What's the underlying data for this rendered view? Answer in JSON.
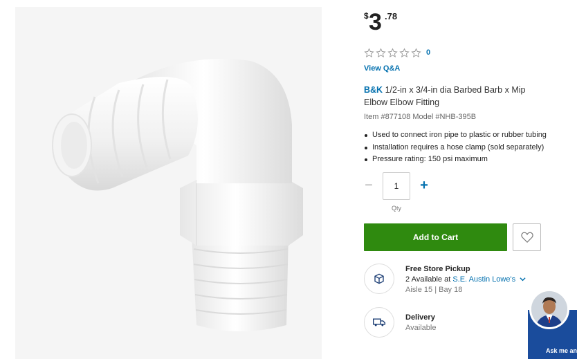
{
  "product": {
    "price": {
      "currency": "$",
      "dollars": "3",
      "cents": ".78"
    },
    "rating": {
      "stars": 0,
      "max_stars": 5,
      "count": "0"
    },
    "view_qa": "View Q&A",
    "title": {
      "brand": "B&K",
      "name": "1/2-in x 3/4-in dia Barbed Barb x Mip Elbow Elbow Fitting"
    },
    "item_model": "Item #877108 Model #NHB-395B",
    "bullets": [
      "Used to connect iron pipe to plastic or rubber tubing",
      "Installation requires a hose clamp (sold separately)",
      "Pressure rating: 150 psi maximum"
    ]
  },
  "quantity": {
    "value": "1",
    "label": "Qty",
    "minus": "−",
    "plus": "+"
  },
  "cart": {
    "add_label": "Add to Cart"
  },
  "pickup": {
    "title": "Free Store Pickup",
    "available": "2 Available",
    "at": "at",
    "store": "S.E. Austin Lowe's",
    "aisle_bay": "Aisle 15 | Bay 18"
  },
  "delivery": {
    "title": "Delivery",
    "status": "Available"
  },
  "chat": {
    "label": "Ask me an"
  },
  "colors": {
    "brand_blue": "#0471af",
    "cart_green": "#2f8a0f",
    "chat_navy": "#1a4c9c"
  },
  "icons": [
    "star-outline-icon",
    "heart-icon",
    "pickup-box-icon",
    "delivery-truck-icon",
    "chevron-down-icon"
  ]
}
